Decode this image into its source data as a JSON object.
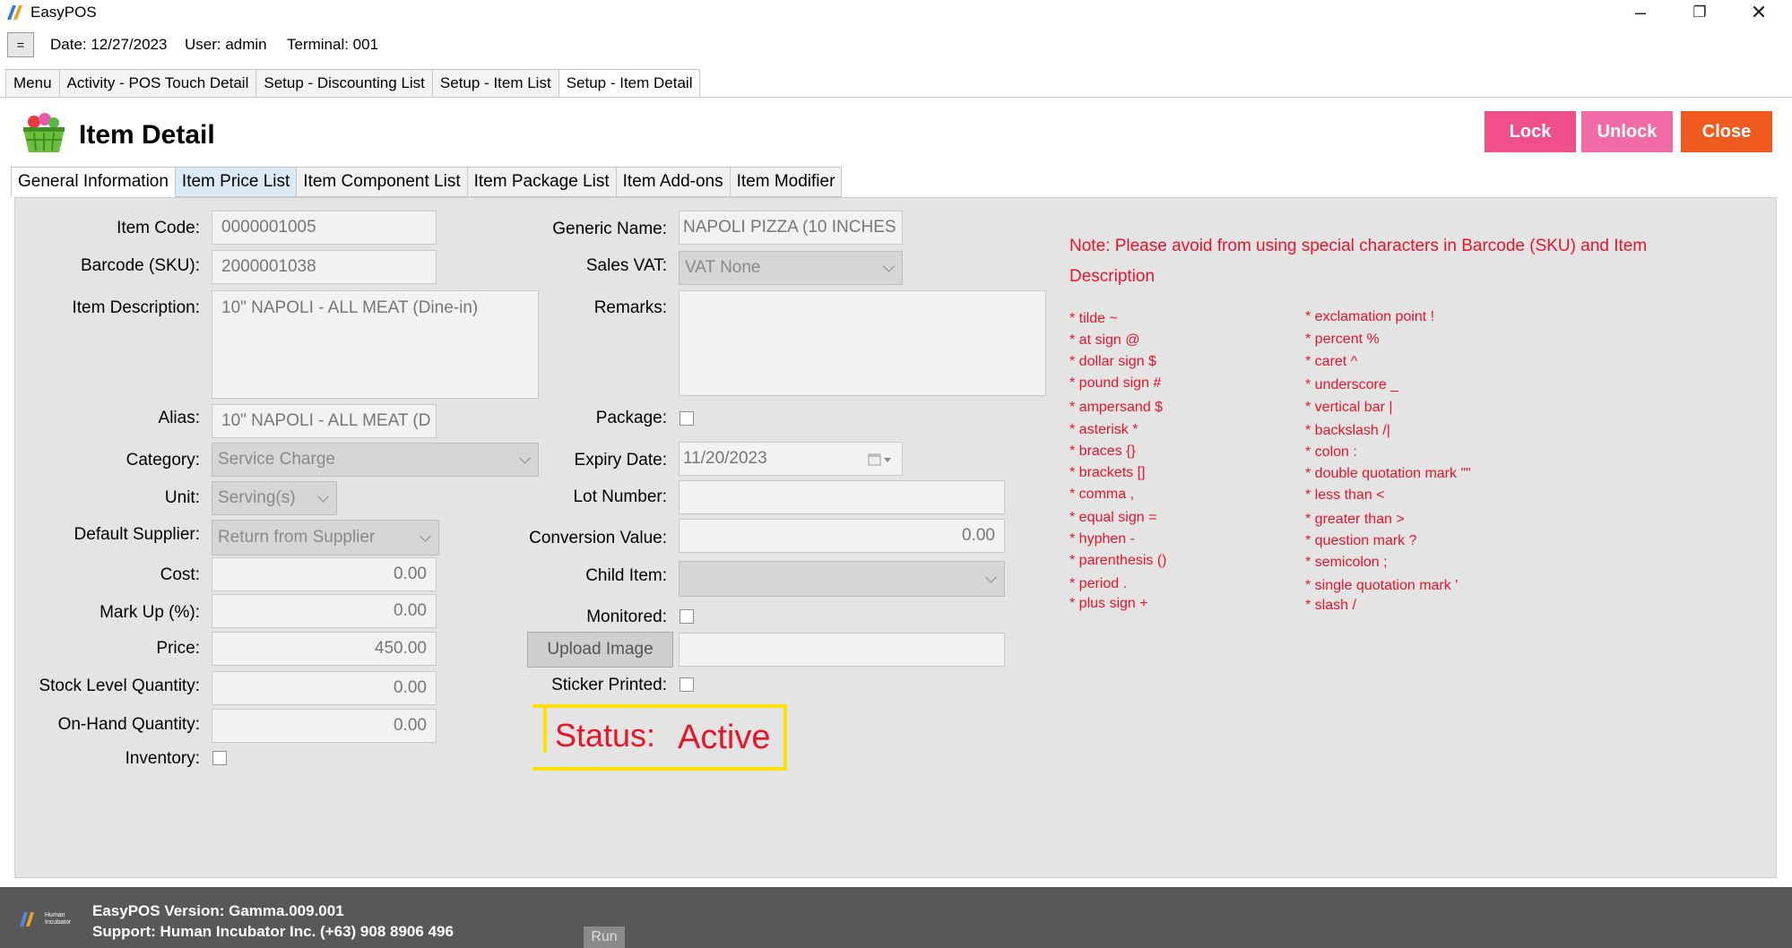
{
  "app": {
    "title": "EasyPOS"
  },
  "infobar": {
    "menu_toggle": "=",
    "date": "Date: 12/27/2023",
    "user": "User: admin",
    "terminal": "Terminal: 001"
  },
  "top_tabs": [
    "Menu",
    "Activity - POS Touch Detail",
    "Setup - Discounting List",
    "Setup - Item List",
    "Setup - Item Detail"
  ],
  "header": {
    "title": "Item Detail",
    "lock": "Lock",
    "unlock": "Unlock",
    "close": "Close"
  },
  "inner_tabs": [
    "General Information",
    "Item Price List",
    "Item Component List",
    "Item Package List",
    "Item Add-ons",
    "Item Modifier"
  ],
  "form": {
    "item_code_label": "Item Code:",
    "item_code": "0000001005",
    "barcode_label": "Barcode (SKU):",
    "barcode": "2000001038",
    "description_label": "Item Description:",
    "description": "10\" NAPOLI - ALL MEAT (Dine-in)",
    "alias_label": "Alias:",
    "alias": "10\" NAPOLI - ALL MEAT (D",
    "category_label": "Category:",
    "category": "Service Charge",
    "unit_label": "Unit:",
    "unit": "Serving(s)",
    "supplier_label": "Default Supplier:",
    "supplier": "Return from Supplier",
    "cost_label": "Cost:",
    "cost": "0.00",
    "markup_label": "Mark Up (%):",
    "markup": "0.00",
    "price_label": "Price:",
    "price": "450.00",
    "stock_label": "Stock Level Quantity:",
    "stock": "0.00",
    "onhand_label": "On-Hand Quantity:",
    "onhand": "0.00",
    "inventory_label": "Inventory:",
    "generic_label": "Generic Name:",
    "generic": "NAPOLI PIZZA (10 INCHES",
    "vat_label": "Sales VAT:",
    "vat": "VAT None",
    "remarks_label": "Remarks:",
    "remarks": "",
    "package_label": "Package:",
    "expiry_label": "Expiry Date:",
    "expiry": "11/20/2023",
    "lot_label": "Lot Number:",
    "lot": "",
    "conversion_label": "Conversion Value:",
    "conversion": "0.00",
    "child_label": "Child Item:",
    "child": "",
    "monitored_label": "Monitored:",
    "upload_label": "Upload Image",
    "upload_path": "",
    "sticker_label": "Sticker Printed:",
    "status_label": "Status:",
    "status_value": "Active"
  },
  "note": {
    "line1": "Note: Please avoid from using special characters in Barcode (SKU) and Item",
    "line2": "Description",
    "left_symbols": [
      "*  tilde ~",
      "* at sign @",
      "* dollar sign $",
      "* pound sign #",
      "* ampersand $",
      "* asterisk *",
      "* braces {}",
      "* brackets []",
      "* comma ,",
      "* equal sign =",
      "* hyphen -",
      "* parenthesis ()",
      "* period .",
      "* plus sign +"
    ],
    "right_symbols": [
      "* exclamation point !",
      "* percent %",
      "* caret  ^",
      "* underscore  _",
      "* vertical bar  |",
      "* backslash  /|",
      "* colon  :",
      "* double quotation mark  \"\"",
      "* less than  <",
      "* greater than  >",
      "* question mark  ?",
      "* semicolon ;",
      "* single quotation mark '",
      "* slash /"
    ]
  },
  "footer": {
    "logo_text": "Human Incubator",
    "version": "EasyPOS Version: Gamma.009.001",
    "support": "Support: Human Incubator Inc. (+63) 908 8906 496",
    "run": "Run"
  },
  "colors": {
    "lock": "#f0508a",
    "unlock": "#f26aa6",
    "close": "#f05a1e",
    "note_red": "#e8152a",
    "status_border": "#ffe100",
    "footer_bg": "#585858"
  }
}
